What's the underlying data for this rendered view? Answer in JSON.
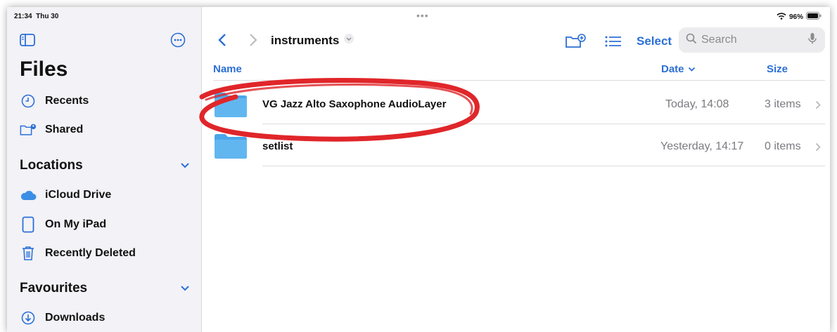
{
  "status": {
    "time": "21:34",
    "date": "Thu 30",
    "battery": "96%"
  },
  "sidebar": {
    "title": "Files",
    "items_top": [
      {
        "label": "Recents",
        "icon": "clock-icon"
      },
      {
        "label": "Shared",
        "icon": "shared-folder-icon"
      }
    ],
    "locations_label": "Locations",
    "locations": [
      {
        "label": "iCloud Drive",
        "icon": "cloud-icon"
      },
      {
        "label": "On My iPad",
        "icon": "ipad-icon"
      },
      {
        "label": "Recently Deleted",
        "icon": "trash-icon"
      }
    ],
    "favourites_label": "Favourites",
    "favourites": [
      {
        "label": "Downloads",
        "icon": "download-icon"
      }
    ]
  },
  "toolbar": {
    "folder_title": "instruments",
    "select_label": "Select",
    "search_placeholder": "Search"
  },
  "table": {
    "headers": {
      "name": "Name",
      "date": "Date",
      "size": "Size"
    },
    "rows": [
      {
        "name": "VG Jazz Alto Saxophone AudioLayer",
        "date": "Today, 14:08",
        "size": "3 items"
      },
      {
        "name": "setlist",
        "date": "Yesterday, 14:17",
        "size": "0 items"
      }
    ]
  },
  "colors": {
    "accent": "#2b6fd6",
    "folder": "#5aaeea",
    "highlight_ellipse": "#e0262a"
  }
}
